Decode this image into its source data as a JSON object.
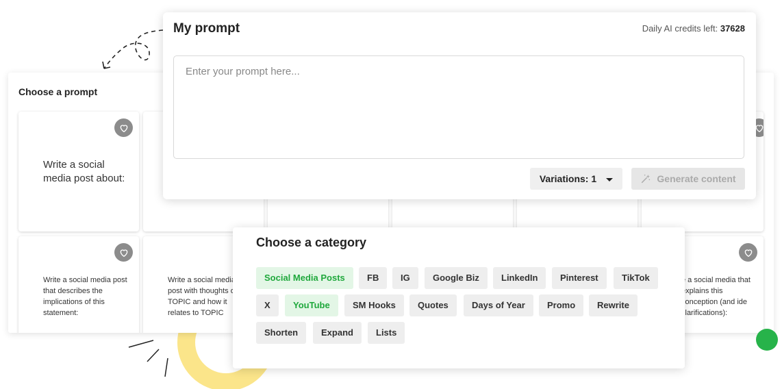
{
  "my_prompt": {
    "title": "My prompt",
    "credits_label": "Daily AI credits left: ",
    "credits_value": "37628",
    "input_placeholder": "Enter your prompt here...",
    "variations_label": "Variations: 1",
    "generate_label": "Generate content"
  },
  "choose_prompt": {
    "title": "Choose a prompt",
    "cards": [
      {
        "text": "Write a social media post about:"
      },
      {
        "text": "Write a social media post that describes the implications of this statement:"
      },
      {
        "text": "Write a social media post with thoughts on TOPIC and how it relates to TOPIC"
      },
      {
        "text": "e a social media that explains this conception (and ide clarifications):"
      }
    ]
  },
  "category": {
    "title": "Choose a category",
    "chips": [
      {
        "label": "Social Media Posts",
        "active": true
      },
      {
        "label": "FB",
        "active": false
      },
      {
        "label": "IG",
        "active": false
      },
      {
        "label": "Google Biz",
        "active": false
      },
      {
        "label": "LinkedIn",
        "active": false
      },
      {
        "label": "Pinterest",
        "active": false
      },
      {
        "label": "TikTok",
        "active": false
      },
      {
        "label": "X",
        "active": false
      },
      {
        "label": "YouTube",
        "active": true
      },
      {
        "label": "SM Hooks",
        "active": false
      },
      {
        "label": "Quotes",
        "active": false
      },
      {
        "label": "Days of Year",
        "active": false
      },
      {
        "label": "Promo",
        "active": false
      },
      {
        "label": "Rewrite",
        "active": false
      },
      {
        "label": "Shorten",
        "active": false
      },
      {
        "label": "Expand",
        "active": false
      },
      {
        "label": "Lists",
        "active": false
      }
    ]
  },
  "icons": {
    "favorite": "heart-icon",
    "dropdown": "caret-down-icon",
    "generate": "magic-wand-icon"
  },
  "colors": {
    "accent_green": "#1fa83c",
    "active_chip_bg": "#e3f6e6",
    "heart_bg": "#8c8c8c",
    "deco_yellow": "#fbe58a"
  }
}
